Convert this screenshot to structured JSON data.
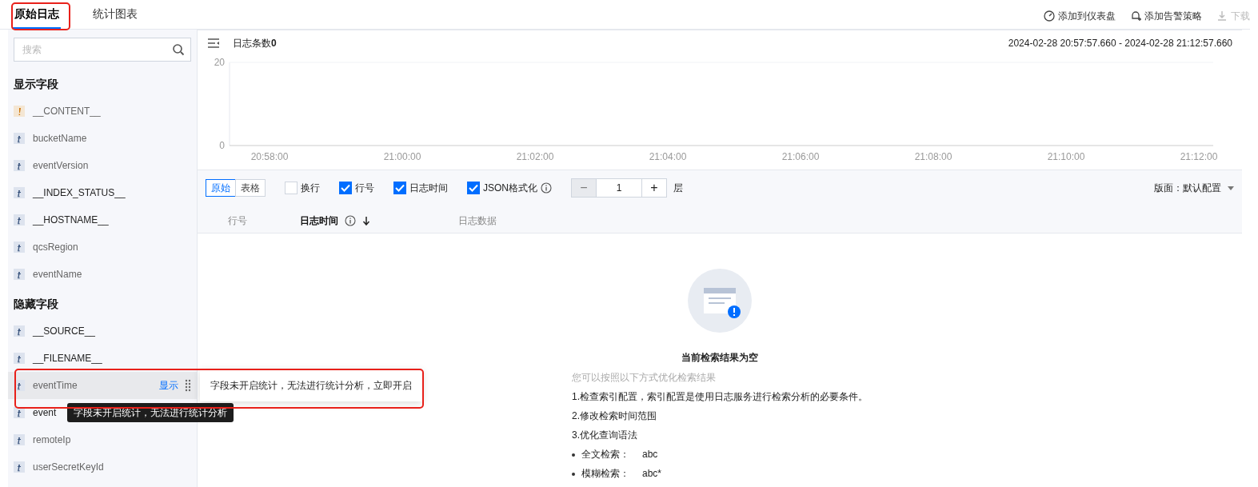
{
  "tabs": [
    {
      "label": "原始日志",
      "selected": true,
      "annotated": true
    },
    {
      "label": "统计图表",
      "selected": false,
      "annotated": false
    }
  ],
  "actions": [
    {
      "label": "添加到仪表盘",
      "kind": "dashboard",
      "disabled": false
    },
    {
      "label": "添加告警策略",
      "kind": "alarm",
      "disabled": false
    },
    {
      "label": "下载",
      "kind": "download",
      "disabled": true
    }
  ],
  "sidebar": {
    "search": {
      "placeholder": "搜索"
    },
    "groups": [
      {
        "title": "显示字段",
        "fields": [
          {
            "name": "__CONTENT__",
            "kind": "warning",
            "dark": false
          },
          {
            "name": "bucketName",
            "kind": "text",
            "dark": false
          },
          {
            "name": "eventVersion",
            "kind": "text",
            "dark": false
          },
          {
            "name": "__INDEX_STATUS__",
            "kind": "text",
            "dark": true
          },
          {
            "name": "__HOSTNAME__",
            "kind": "text",
            "dark": true
          },
          {
            "name": "qcsRegion",
            "kind": "text",
            "dark": false
          },
          {
            "name": "eventName",
            "kind": "text",
            "dark": false
          }
        ]
      },
      {
        "title": "隐藏字段",
        "fields": [
          {
            "name": "__SOURCE__",
            "kind": "text",
            "dark": true
          },
          {
            "name": "__FILENAME__",
            "kind": "text",
            "dark": true
          },
          {
            "name": "eventTime",
            "kind": "text",
            "dark": false,
            "hovered": true,
            "action": "显示",
            "popover": {
              "text": "字段未开启统计，无法进行统计分析，",
              "link": "立即开启",
              "annotated": true
            }
          },
          {
            "name": "event",
            "kind": "text",
            "dark": true,
            "tooltip": "字段未开启统计，无法进行统计分析"
          },
          {
            "name": "remoteIp",
            "kind": "text",
            "dark": false
          },
          {
            "name": "userSecretKeyId",
            "kind": "text",
            "dark": false
          }
        ]
      }
    ]
  },
  "summary": {
    "label": "日志条数",
    "count": "0",
    "time_range": "2024-02-28 20:57:57.660 - 2024-02-28 21:12:57.660"
  },
  "chart": {
    "chart_data": {
      "type": "bar",
      "categories": [
        "20:58:00",
        "21:00:00",
        "21:02:00",
        "21:04:00",
        "21:06:00",
        "21:08:00",
        "21:10:00",
        "21:12:00"
      ],
      "ylim": [
        0,
        20
      ],
      "yticks": [
        0,
        20
      ]
    }
  },
  "toolbar": {
    "view_modes": [
      {
        "label": "原始",
        "selected": true
      },
      {
        "label": "表格",
        "selected": false
      }
    ],
    "options": [
      {
        "label": "换行",
        "checked": false,
        "info": false
      },
      {
        "label": "行号",
        "checked": true,
        "info": false
      },
      {
        "label": "日志时间",
        "checked": true,
        "info": false
      },
      {
        "label": "JSON格式化",
        "checked": true,
        "info": true
      }
    ],
    "depth": {
      "minus": "−",
      "value": "1",
      "plus": "+",
      "unit": "层"
    },
    "layout": "版面：默认配置"
  },
  "columns": [
    {
      "label": "行号",
      "bold": false,
      "info": false,
      "sorted": false
    },
    {
      "label": "日志时间",
      "bold": true,
      "info": true,
      "sorted": true
    },
    {
      "label": "日志数据",
      "bold": false,
      "info": false,
      "sorted": false
    }
  ],
  "empty_state": {
    "title": "当前检索结果为空",
    "subtitle": "您可以按照以下方式优化检索结果",
    "items": [
      {
        "kind": "step",
        "prefix": "1.检查",
        "link": "索引配置",
        "suffix": "，索引配置是使用日志服务进行检索分析的必要条件。"
      },
      {
        "kind": "step",
        "prefix": "2.修改检索时间范围"
      },
      {
        "kind": "step",
        "prefix": "3.优化查询语法"
      },
      {
        "kind": "example",
        "label": "全文检索：",
        "value": "abc"
      },
      {
        "kind": "example",
        "label": "模糊检索：",
        "value": "abc*"
      }
    ]
  }
}
